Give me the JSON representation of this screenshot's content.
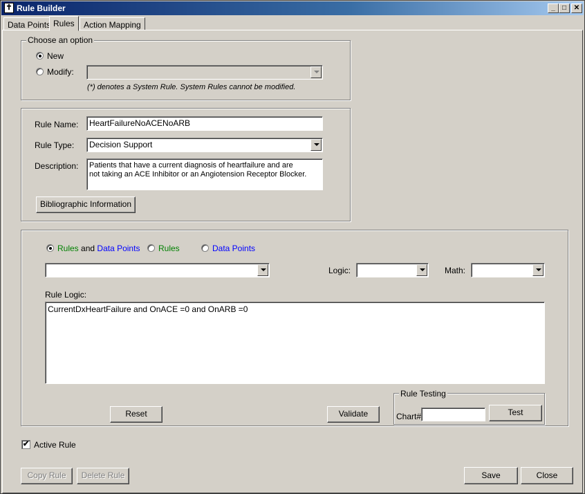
{
  "window": {
    "title": "Rule Builder",
    "minimize": "_",
    "maximize": "□",
    "close": "✕"
  },
  "tabs": [
    {
      "label": "Data Points"
    },
    {
      "label": "Rules"
    },
    {
      "label": "Action Mapping"
    }
  ],
  "option_group": {
    "legend": "Choose an option",
    "new_label": "New",
    "modify_label": "Modify:",
    "modify_value": "",
    "note": "(*) denotes a System Rule. System Rules cannot be modified."
  },
  "details": {
    "rule_name_label": "Rule Name:",
    "rule_name_value": "HeartFailureNoACENoARB",
    "rule_type_label": "Rule Type:",
    "rule_type_value": "Decision Support",
    "description_label": "Description:",
    "description_value": "Patients that have a current diagnosis of heartfailure and are\nnot taking an ACE Inhibitor or an Angiotension Receptor Blocker.",
    "biblio_button": "Bibliographic Information"
  },
  "logic": {
    "filter_rules": "Rules",
    "filter_and": "and",
    "filter_datapoints": "Data Points",
    "filter_rules_only": "Rules",
    "filter_datapoints_only": "Data Points",
    "selector_value": "",
    "logic_label": "Logic:",
    "logic_value": "",
    "math_label": "Math:",
    "math_value": "",
    "rule_logic_label": "Rule Logic:",
    "rule_logic_value": "CurrentDxHeartFailure and OnACE =0 and OnARB =0",
    "reset_button": "Reset",
    "validate_button": "Validate",
    "testing_legend": "Rule Testing",
    "chart_label": "Chart#",
    "chart_value": "",
    "test_button": "Test"
  },
  "footer": {
    "active_rule_label": "Active Rule",
    "active_checked": "✔",
    "copy_button": "Copy Rule",
    "delete_button": "Delete Rule",
    "save_button": "Save",
    "close_button": "Close"
  }
}
